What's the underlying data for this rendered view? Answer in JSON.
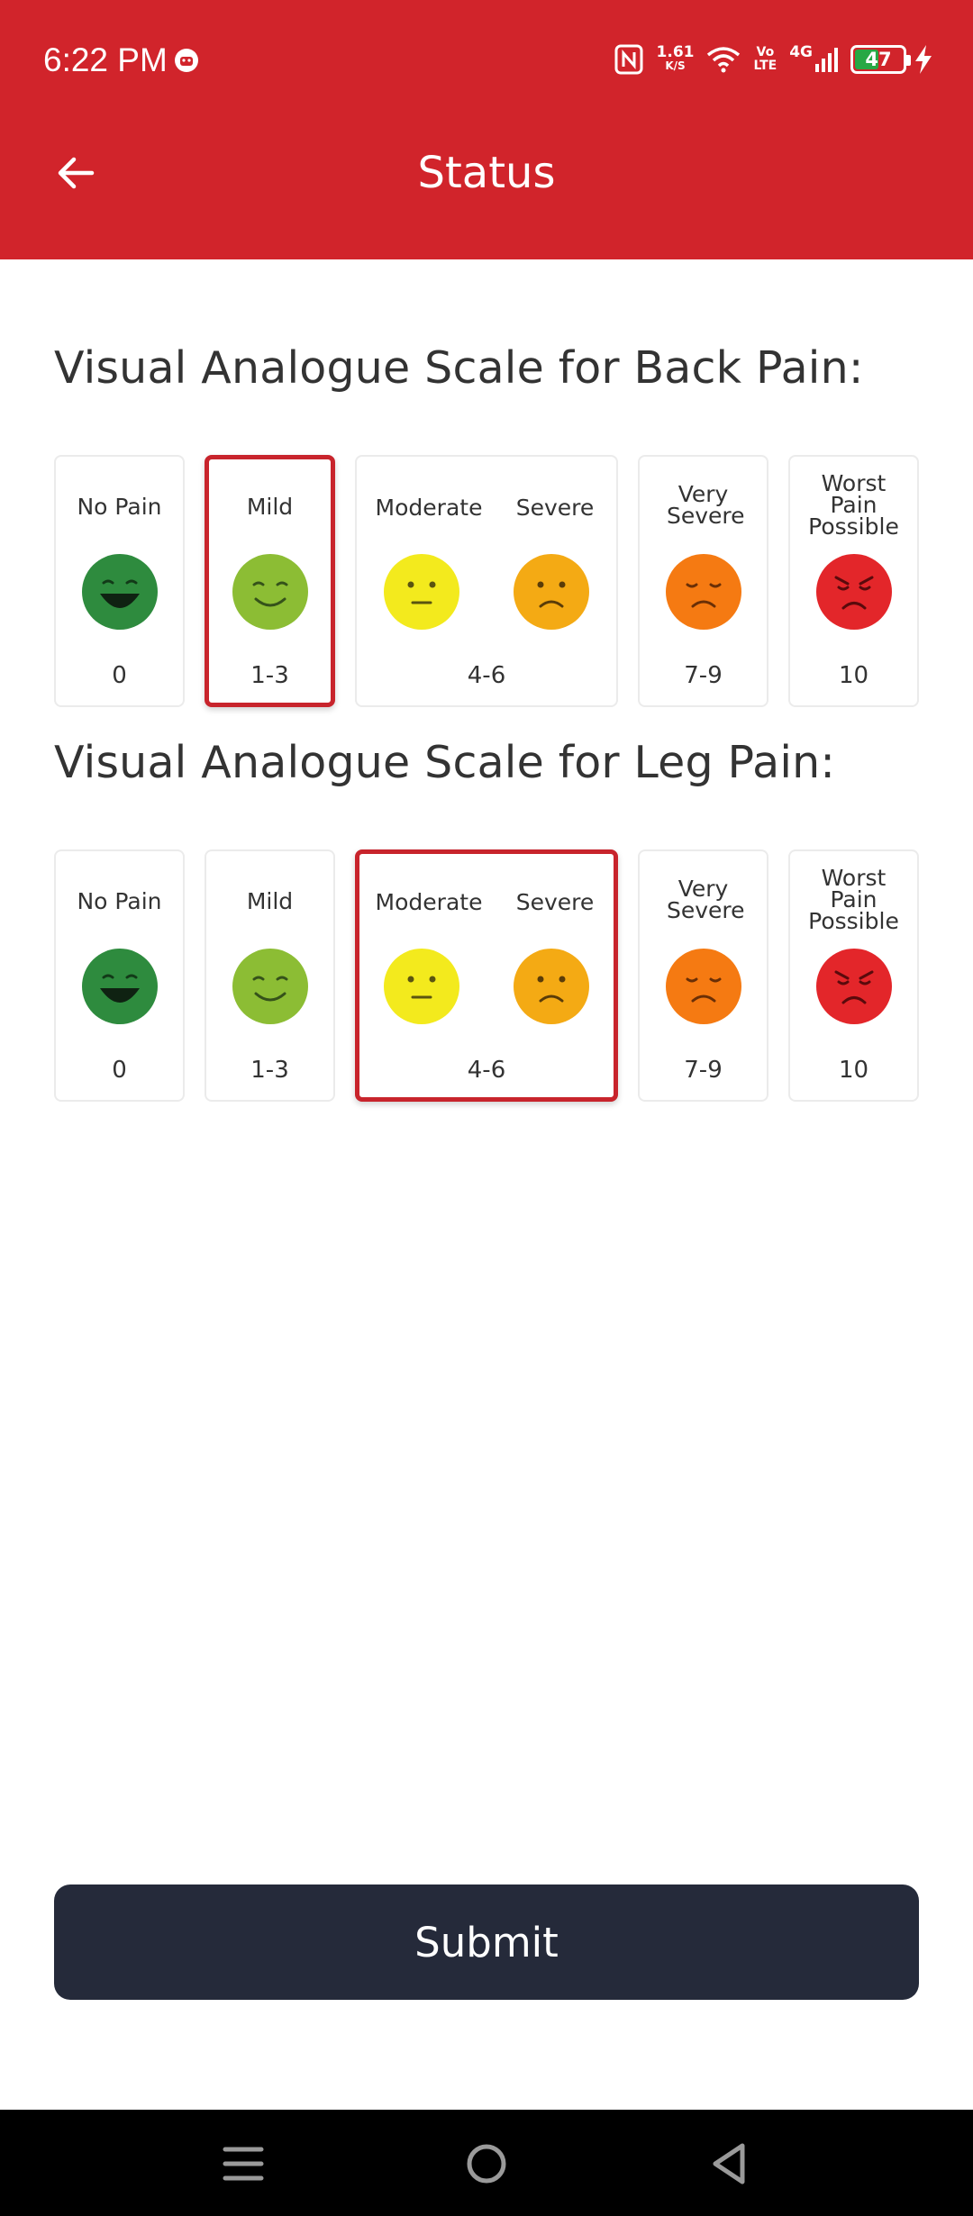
{
  "status_bar": {
    "time": "6:22 PM",
    "speed_value": "1.61",
    "speed_unit": "K/S",
    "volte_top": "Vo",
    "volte_bottom": "LTE",
    "network": "4G",
    "battery": "47",
    "battery_level": 0.47
  },
  "header": {
    "title": "Status"
  },
  "back_pain": {
    "title": "Visual Analogue Scale for Back Pain:",
    "selected": "1-3",
    "options": [
      {
        "label": "No Pain",
        "range": "0"
      },
      {
        "label": "Mild",
        "range": "1-3"
      },
      {
        "label_left": "Moderate",
        "label_right": "Severe",
        "range": "4-6"
      },
      {
        "label": "Very Severe",
        "range": "7-9"
      },
      {
        "label": "Worst Pain Possible",
        "range": "10"
      }
    ]
  },
  "leg_pain": {
    "title": "Visual Analogue Scale for Leg Pain:",
    "selected": "4-6",
    "options": [
      {
        "label": "No Pain",
        "range": "0"
      },
      {
        "label": "Mild",
        "range": "1-3"
      },
      {
        "label_left": "Moderate",
        "label_right": "Severe",
        "range": "4-6"
      },
      {
        "label": "Very Severe",
        "range": "7-9"
      },
      {
        "label": "Worst Pain Possible",
        "range": "10"
      }
    ]
  },
  "face_colors": {
    "no_pain": "#2e8b3e",
    "mild": "#8cbd34",
    "moderate": "#f3ea1d",
    "severe": "#f4aa14",
    "very_severe": "#f57a12",
    "worst": "#e3262a"
  },
  "submit": {
    "label": "Submit"
  },
  "nav": {
    "recents": "menu-icon",
    "home": "home-circle-icon",
    "back": "back-triangle-icon"
  }
}
